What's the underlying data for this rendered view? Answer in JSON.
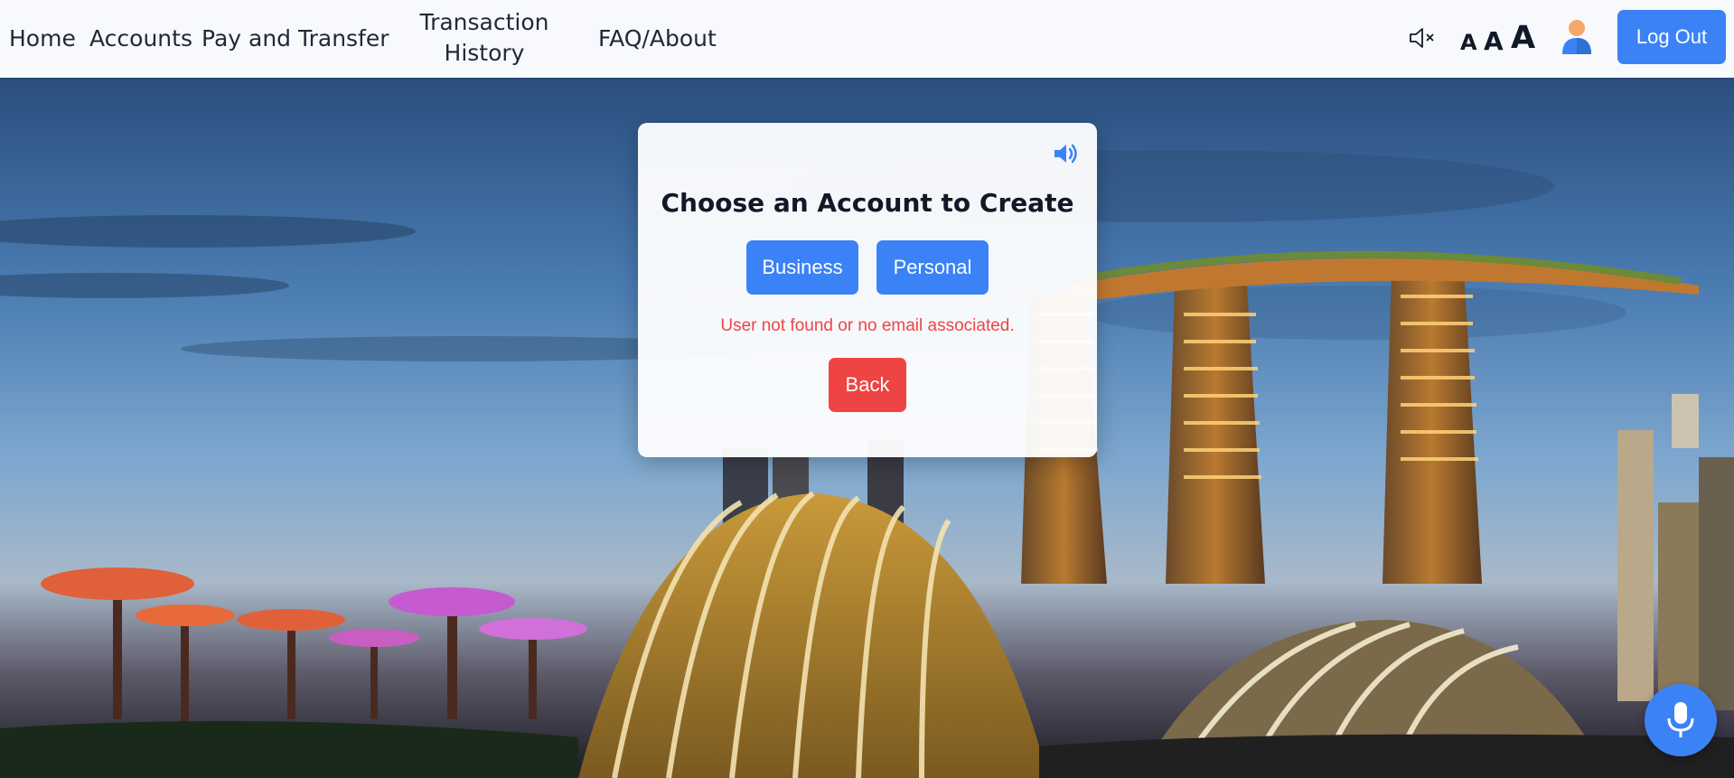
{
  "navbar": {
    "links": {
      "home": "Home",
      "accounts": "Accounts",
      "pay_transfer": "Pay and Transfer",
      "transaction_history_line1": "Transaction",
      "transaction_history_line2": "History",
      "faq": "FAQ/About"
    },
    "font_size_buttons": {
      "small": "A",
      "medium": "A",
      "large": "A"
    },
    "logout_label": "Log Out",
    "icons": {
      "sound": "speaker-muted-icon",
      "profile": "user-avatar-icon"
    }
  },
  "modal": {
    "title": "Choose an Account to Create",
    "business_label": "Business",
    "personal_label": "Personal",
    "error_message": "User not found or no email associated.",
    "back_label": "Back",
    "icons": {
      "read_aloud": "speaker-on-icon"
    }
  },
  "floating": {
    "voice_icon": "microphone-icon"
  },
  "colors": {
    "primary": "#3b82f6",
    "danger": "#ef4444",
    "navbar_bg": "#f7f9fc"
  }
}
